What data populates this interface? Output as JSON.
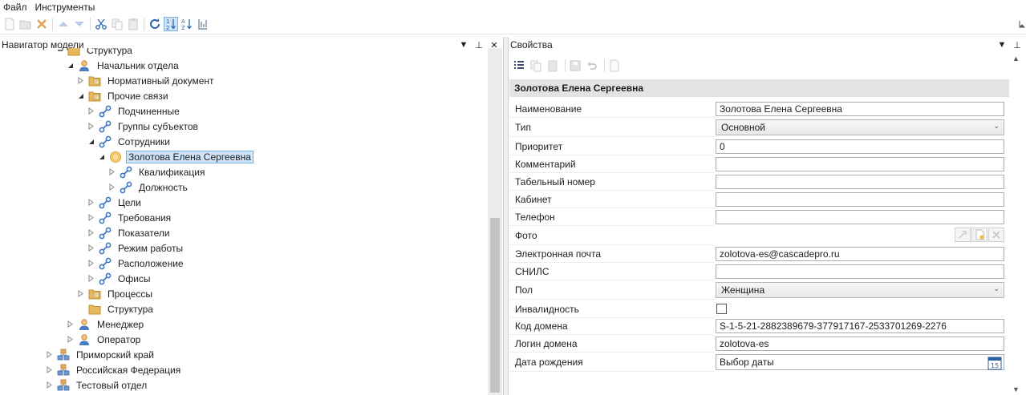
{
  "menu": {
    "items": [
      "Файл",
      "Инструменты"
    ]
  },
  "toolbar": {
    "icons": [
      "new-icon",
      "open-icon",
      "delete-icon",
      "move-up-icon",
      "move-down-icon",
      "cut-icon",
      "copy-icon",
      "paste-icon",
      "refresh-icon",
      "sort-numeric-icon",
      "sort-alpha-icon",
      "sort-custom-icon"
    ]
  },
  "navigator": {
    "title": "Навигатор модели",
    "tree": [
      {
        "label": "Структура",
        "level": 2,
        "icon": "folder-icon",
        "toggle": "collapse"
      },
      {
        "label": "Начальник отдела",
        "level": 3,
        "icon": "person-icon",
        "toggle": "expanded"
      },
      {
        "label": "Нормативный документ",
        "level": 4,
        "icon": "folder-doc-icon",
        "toggle": "collapsed"
      },
      {
        "label": "Прочие связи",
        "level": 4,
        "icon": "folder-doc-icon",
        "toggle": "expanded"
      },
      {
        "label": "Подчиненные",
        "level": 5,
        "icon": "link-icon",
        "toggle": "collapsed"
      },
      {
        "label": "Группы субъектов",
        "level": 5,
        "icon": "link-icon",
        "toggle": "collapsed"
      },
      {
        "label": "Сотрудники",
        "level": 5,
        "icon": "link-icon",
        "toggle": "expanded"
      },
      {
        "label": "Золотова Елена Сергеевна",
        "level": 6,
        "icon": "employee-icon",
        "toggle": "expanded",
        "selected": true
      },
      {
        "label": "Квалификация",
        "level": 7,
        "icon": "link-icon",
        "toggle": "collapsed"
      },
      {
        "label": "Должность",
        "level": 7,
        "icon": "link-icon",
        "toggle": "collapsed"
      },
      {
        "label": "Цели",
        "level": 5,
        "icon": "link-icon",
        "toggle": "collapsed"
      },
      {
        "label": "Требования",
        "level": 5,
        "icon": "link-icon",
        "toggle": "collapsed"
      },
      {
        "label": "Показатели",
        "level": 5,
        "icon": "link-icon",
        "toggle": "collapsed"
      },
      {
        "label": "Режим работы",
        "level": 5,
        "icon": "link-icon",
        "toggle": "collapsed"
      },
      {
        "label": "Расположение",
        "level": 5,
        "icon": "link-icon",
        "toggle": "collapsed"
      },
      {
        "label": "Офисы",
        "level": 5,
        "icon": "link-icon",
        "toggle": "collapsed"
      },
      {
        "label": "Процессы",
        "level": 4,
        "icon": "folder-doc-icon",
        "toggle": "collapsed"
      },
      {
        "label": "Структура",
        "level": 4,
        "icon": "folder-icon",
        "toggle": "none"
      },
      {
        "label": "Менеджер",
        "level": 3,
        "icon": "person-icon",
        "toggle": "collapsed"
      },
      {
        "label": "Оператор",
        "level": 3,
        "icon": "person-icon",
        "toggle": "collapsed"
      },
      {
        "label": "Приморский край",
        "level": 1,
        "icon": "org-icon",
        "toggle": "collapsed"
      },
      {
        "label": "Российская Федерация",
        "level": 1,
        "icon": "org-icon",
        "toggle": "collapsed"
      },
      {
        "label": "Тестовый отдел",
        "level": 1,
        "icon": "org-icon",
        "toggle": "collapsed"
      }
    ]
  },
  "properties": {
    "title": "Свойства",
    "toolbar_icons": [
      "categorized-icon",
      "copy-icon",
      "paste-icon",
      "save-icon",
      "undo-icon",
      "document-icon"
    ],
    "section": "Золотова Елена Сергеевна",
    "rows": [
      {
        "name": "Наименование",
        "value": "Золотова Елена Сергеевна",
        "kind": "text"
      },
      {
        "name": "Тип",
        "value": "Основной",
        "kind": "combo"
      },
      {
        "name": "Приоритет",
        "value": "0",
        "kind": "text"
      },
      {
        "name": "Комментарий",
        "value": "",
        "kind": "text"
      },
      {
        "name": "Табельный номер",
        "value": "",
        "kind": "text"
      },
      {
        "name": "Кабинет",
        "value": "",
        "kind": "text"
      },
      {
        "name": "Телефон",
        "value": "",
        "kind": "text"
      },
      {
        "name": "Фото",
        "value": "",
        "kind": "photo"
      },
      {
        "name": "Электронная почта",
        "value": "zolotova-es@cascadepro.ru",
        "kind": "text"
      },
      {
        "name": "СНИЛС",
        "value": "",
        "kind": "text"
      },
      {
        "name": "Пол",
        "value": "Женщина",
        "kind": "combo"
      },
      {
        "name": "Инвалидность",
        "value": "",
        "kind": "check",
        "checked": false
      },
      {
        "name": "Код домена",
        "value": "S-1-5-21-2882389679-377917167-2533701269-2276",
        "kind": "text"
      },
      {
        "name": "Логин домена",
        "value": "zolotova-es",
        "kind": "text"
      },
      {
        "name": "Дата рождения",
        "value": "Выбор даты",
        "kind": "date"
      }
    ]
  },
  "colors": {
    "accent": "#3a78c4",
    "selection": "#cde4fb",
    "section_bg": "#e3e3e3"
  }
}
